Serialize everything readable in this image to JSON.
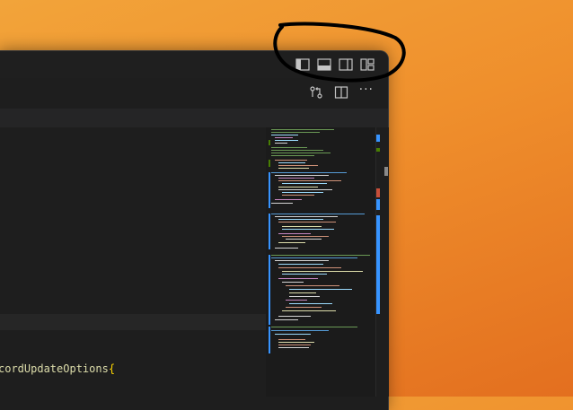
{
  "editor": {
    "visible_code_fragment": "cordUpdateOptions",
    "brace": "{"
  },
  "title_bar": {
    "layout_controls": [
      {
        "name": "toggle-primary-sidebar",
        "icon": "sidebar-left-icon"
      },
      {
        "name": "toggle-panel",
        "icon": "panel-bottom-icon"
      },
      {
        "name": "toggle-secondary-sidebar",
        "icon": "sidebar-right-icon"
      },
      {
        "name": "customize-layout",
        "icon": "layout-customize-icon"
      }
    ]
  },
  "editor_actions": [
    {
      "name": "open-changes",
      "icon": "source-control-compare-icon"
    },
    {
      "name": "split-editor",
      "icon": "split-editor-icon"
    },
    {
      "name": "more-actions",
      "icon": "ellipsis-icon",
      "label": "···"
    }
  ],
  "colors": {
    "desktop_top": "#f2a43a",
    "desktop_bottom": "#e36f1f",
    "editor_bg": "#1e1e1e",
    "annotation": "#000000",
    "git_added": "#3794ff",
    "code_function": "#dcdcaa"
  }
}
